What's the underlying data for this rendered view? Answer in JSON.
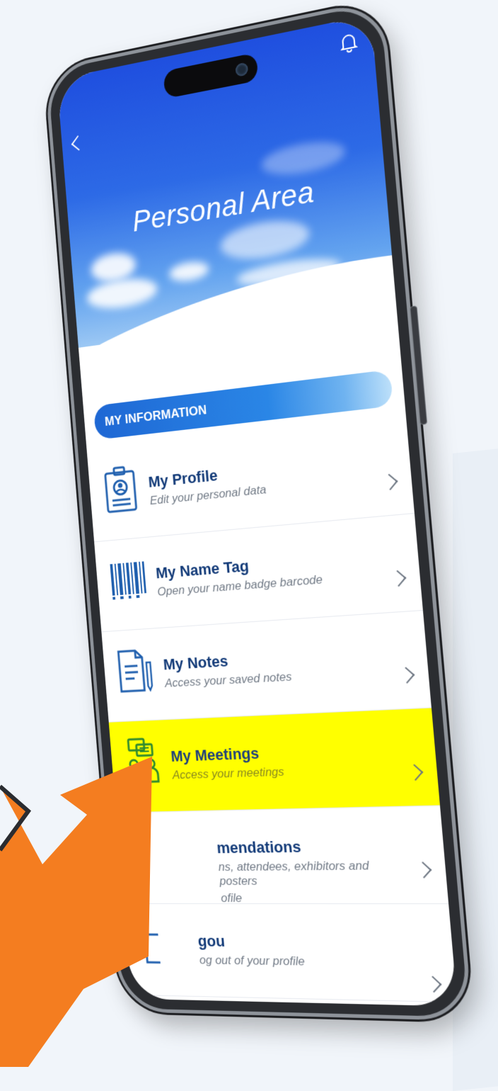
{
  "screen": {
    "title": "Personal Area",
    "section_label": "MY INFORMATION"
  },
  "icons": {
    "back": "chevron-left-icon",
    "bell": "bell-icon",
    "chevron": "chevron-right-icon",
    "pointer": "orange-arrow-pointer"
  },
  "colors": {
    "header_blue": "#2d6ae6",
    "accent_navy": "#123a78",
    "highlight": "#ffff00",
    "arrow": "#f47d20"
  },
  "menu": {
    "items": [
      {
        "label": "My Profile",
        "subtitle": "Edit your personal data",
        "icon": "id-badge-icon"
      },
      {
        "label": "My Name Tag",
        "subtitle": "Open your name badge barcode",
        "icon": "barcode-icon"
      },
      {
        "label": "My Notes",
        "subtitle": "Access your saved notes",
        "icon": "notes-icon"
      },
      {
        "label": "My Meetings",
        "subtitle": "Access your meetings",
        "icon": "meetings-icon",
        "highlighted": true
      },
      {
        "label": "mendations",
        "subtitle": "ns, attendees, exhibitors and posters",
        "subtitle2": "ofile",
        "icon": "recommendations-icon"
      },
      {
        "label": "gou",
        "subtitle": "og out of your profile",
        "icon": "logout-icon"
      }
    ]
  }
}
